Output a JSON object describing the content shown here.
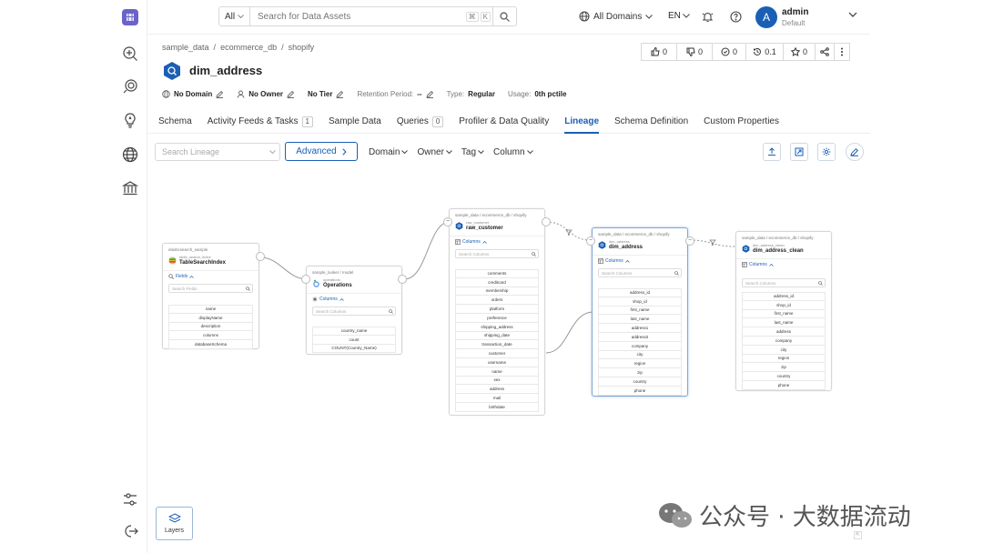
{
  "topbar": {
    "search_scope": "All",
    "search_placeholder": "Search for Data Assets",
    "shortcut_keys": [
      "⌘",
      "K"
    ],
    "domains_label": "All Domains",
    "language": "EN",
    "user_initial": "A",
    "user_name": "admin",
    "user_role": "Default"
  },
  "breadcrumb": [
    "sample_data",
    "ecommerce_db",
    "shopify"
  ],
  "breadcrumb_sep": "/",
  "entity": {
    "title": "dim_address"
  },
  "actions": {
    "up_votes": "0",
    "down_votes": "0",
    "watchers": "0",
    "version": "0.1",
    "stars": "0"
  },
  "meta": {
    "domain": "No Domain",
    "owner": "No Owner",
    "tier": "No Tier",
    "retention_label": "Retention Period:",
    "retention_value": "--",
    "type_label": "Type:",
    "type_value": "Regular",
    "usage_label": "Usage:",
    "usage_value": "0th pctile"
  },
  "tabs": [
    {
      "label": "Schema"
    },
    {
      "label": "Activity Feeds & Tasks",
      "badge": "1"
    },
    {
      "label": "Sample Data"
    },
    {
      "label": "Queries",
      "badge": "0"
    },
    {
      "label": "Profiler & Data Quality"
    },
    {
      "label": "Lineage",
      "active": true
    },
    {
      "label": "Schema Definition"
    },
    {
      "label": "Custom Properties"
    }
  ],
  "lineage_toolbar": {
    "search_placeholder": "Search Lineage",
    "advanced_label": "Advanced",
    "filters": [
      "Domain",
      "Owner",
      "Tag",
      "Column"
    ]
  },
  "nodes": {
    "search_index": {
      "path": "elasticsearch_sample",
      "sub": "table_search_index",
      "name": "TableSearchIndex",
      "section": "Fields",
      "search": "Search Fields",
      "rows": [
        "name",
        "displayName",
        "description",
        "columns",
        "databaseSchema"
      ]
    },
    "operations": {
      "path": "sample_looker / model",
      "sub": "operations",
      "name": "Operations",
      "section": "Columns",
      "search": "Search Columns",
      "rows": [
        "country_name",
        "count",
        "COUNT(Country_Name)"
      ]
    },
    "raw_customer": {
      "path": "sample_data / ecommerce_db / shopify",
      "sub": "raw_customer",
      "name": "raw_customer",
      "section": "Columns",
      "search": "Search Columns",
      "rows": [
        "comments",
        "creditcard",
        "membership",
        "orders",
        "platform",
        "preference",
        "shipping_address",
        "shipping_date",
        "transaction_date",
        "customer",
        "username",
        "name",
        "sex",
        "address",
        "mail",
        "birthdate"
      ]
    },
    "dim_address": {
      "path": "sample_data / ecommerce_db / shopify",
      "sub": "dim_address",
      "name": "dim_address",
      "section": "Columns",
      "search": "Search Columns",
      "rows": [
        "address_id",
        "shop_id",
        "first_name",
        "last_name",
        "address1",
        "address2",
        "company",
        "city",
        "region",
        "zip",
        "country",
        "phone"
      ]
    },
    "dim_address_clean": {
      "path": "sample_data / ecommerce_db / shopify",
      "sub": "dim_address_clean",
      "name": "dim_address_clean",
      "section": "Columns",
      "search": "Search Columns",
      "rows": [
        "address_id",
        "shop_id",
        "first_name",
        "last_name",
        "address",
        "company",
        "city",
        "region",
        "zip",
        "country",
        "phone"
      ]
    }
  },
  "layers_label": "Layers",
  "watermark_text": "公众号 · 大数据流动",
  "colors": {
    "accent": "#1a5fb4",
    "edge": "#999999"
  }
}
